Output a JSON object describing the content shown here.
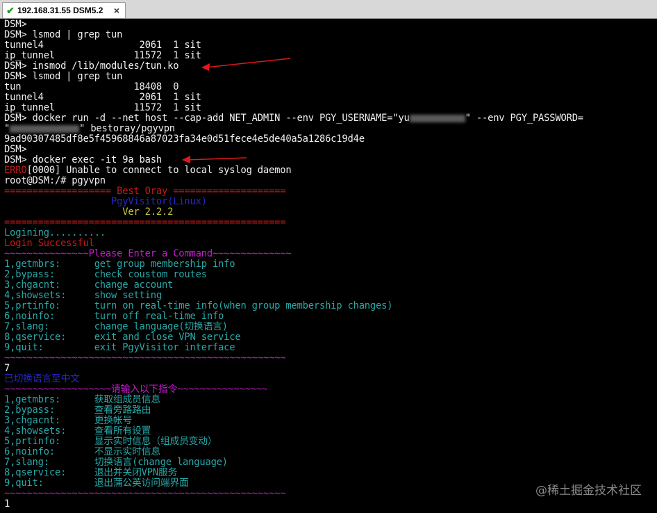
{
  "tab": {
    "title": "192.168.31.55 DSM5.2",
    "close": "×",
    "check": "✔"
  },
  "lines": {
    "l01": "DSM>",
    "l02": "DSM> lsmod | grep tun",
    "l03": "tunnel4                 2061  1 sit",
    "l04": "ip_tunnel              11572  1 sit",
    "l05": "DSM> insmod /lib/modules/tun.ko",
    "l06": "DSM> lsmod | grep tun",
    "l07": "tun                    18408  0",
    "l08": "tunnel4                 2061  1 sit",
    "l09": "ip_tunnel              11572  1 sit",
    "l10a": "DSM> docker run -d --net host --cap-add NET_ADMIN --env PGY_USERNAME=\"yu",
    "l10b": "\" --env PGY_PASSWORD=",
    "l11a": "\"",
    "l11b": "\" bestoray/pgyvpn",
    "l12": "9ad90307485df8e5f45968846a87023fa34e0d51fece4e5de40a5a1286c19d4e",
    "l13": "DSM>",
    "l14": "DSM> docker exec -it 9a bash",
    "l15a": "ERRO",
    "l15b": "[0000] Unable to connect to local syslog daemon",
    "l16": "root@DSM:/# pgyvpn",
    "l17": "=================== Best Oray ====================",
    "l18": "                   PgyVisitor(Linux)",
    "l19": "                     Ver 2.2.2",
    "l20": "==================================================",
    "l21": "Logining..........",
    "l22": "Login Successful",
    "l23": "~~~~~~~~~~~~~~~Please Enter a Command~~~~~~~~~~~~~~",
    "l24": "1,getmbrs:      get group membership info",
    "l25": "2,bypass:       check coustom routes",
    "l26": "3,chgacnt:      change account",
    "l27": "4,showsets:     show setting",
    "l28": "5,prtinfo:      turn on real-time info(when group membership changes)",
    "l29": "6,noinfo:       turn off real-time info",
    "l30": "7,slang:        change language(切换语言)",
    "l31": "8,qservice:     exit and close VPN service",
    "l32": "9,quit:         exit PgyVisitor interface",
    "l33": "~~~~~~~~~~~~~~~~~~~~~~~~~~~~~~~~~~~~~~~~~~~~~~~~~~",
    "l34": "7",
    "l35": "已切换语言至中文",
    "l36": "~~~~~~~~~~~~~~~~~~~请输入以下指令~~~~~~~~~~~~~~~~",
    "l37": "1,getmbrs:      获取组成员信息",
    "l38": "2,bypass:       查看旁路路由",
    "l39": "3,chgacnt:      更换帐号",
    "l40": "4,showsets:     查看所有设置",
    "l41": "5,prtinfo:      显示实时信息（组成员变动）",
    "l42": "6,noinfo:       不显示实时信息",
    "l43": "7,slang:        切换语言(change language)",
    "l44": "8,qservice:     退出并关闭VPN服务",
    "l45": "9,quit:         退出蒲公英访问端界面",
    "l46": "~~~~~~~~~~~~~~~~~~~~~~~~~~~~~~~~~~~~~~~~~~~~~~~~~~",
    "l47": "1"
  },
  "watermark": "@稀土掘金技术社区",
  "colors": {
    "terminal_bg": "#000000",
    "text": "#f0f0f0",
    "teal": "#2aa8a8",
    "red": "#c81818",
    "magenta": "#c41ecf",
    "blue": "#2828c8",
    "yellow": "#c8c832",
    "arrow": "#e01818"
  }
}
